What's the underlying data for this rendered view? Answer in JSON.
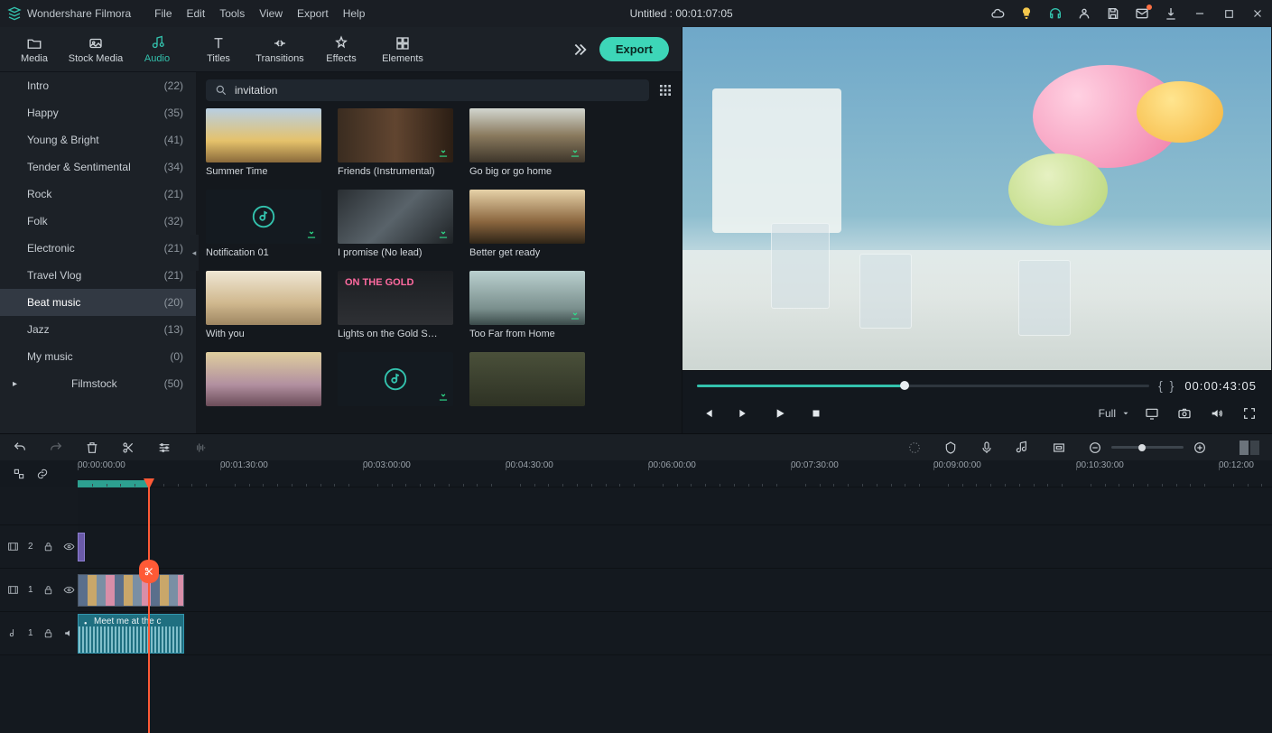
{
  "app": {
    "name": "Wondershare Filmora"
  },
  "menu": [
    "File",
    "Edit",
    "Tools",
    "View",
    "Export",
    "Help"
  ],
  "document": {
    "title_status": "Untitled : 00:01:07:05"
  },
  "tabs": {
    "items": [
      {
        "label": "Media",
        "icon": "folder"
      },
      {
        "label": "Stock Media",
        "icon": "stock"
      },
      {
        "label": "Audio",
        "icon": "music"
      },
      {
        "label": "Titles",
        "icon": "text"
      },
      {
        "label": "Transitions",
        "icon": "transition"
      },
      {
        "label": "Effects",
        "icon": "sparkle"
      },
      {
        "label": "Elements",
        "icon": "elements"
      }
    ],
    "active": 2,
    "export_label": "Export"
  },
  "search": {
    "value": "invitation"
  },
  "categories": [
    {
      "label": "Intro",
      "count": "(22)"
    },
    {
      "label": "Happy",
      "count": "(35)"
    },
    {
      "label": "Young & Bright",
      "count": "(41)"
    },
    {
      "label": "Tender & Sentimental",
      "count": "(34)"
    },
    {
      "label": "Rock",
      "count": "(21)"
    },
    {
      "label": "Folk",
      "count": "(32)"
    },
    {
      "label": "Electronic",
      "count": "(21)"
    },
    {
      "label": "Travel Vlog",
      "count": "(21)"
    },
    {
      "label": "Beat music",
      "count": "(20)",
      "selected": true
    },
    {
      "label": "Jazz",
      "count": "(13)"
    },
    {
      "label": "My music",
      "count": "(0)"
    },
    {
      "label": "Filmstock",
      "count": "(50)",
      "filmstock": true
    }
  ],
  "assets": [
    {
      "caption": "Summer Time",
      "scene": "sc-sunflower",
      "dl": false
    },
    {
      "caption": "Friends (Instrumental)",
      "scene": "sc-friends",
      "dl": true
    },
    {
      "caption": "Go big or go home",
      "scene": "sc-road",
      "dl": true
    },
    {
      "caption": "Notification 01",
      "scene": "sc-dark",
      "dl": true,
      "musicIcon": true
    },
    {
      "caption": "I promise (No lead)",
      "scene": "sc-guitar",
      "dl": true
    },
    {
      "caption": "Better get ready",
      "scene": "sc-sunset",
      "dl": false
    },
    {
      "caption": "With you",
      "scene": "sc-beach",
      "dl": false
    },
    {
      "caption": "Lights on the Gold S…",
      "scene": "sc-gold",
      "dl": false,
      "goldText": true
    },
    {
      "caption": "Too Far from Home",
      "scene": "sc-home",
      "dl": true
    },
    {
      "caption": "",
      "scene": "sc-woman",
      "dl": false
    },
    {
      "caption": "",
      "scene": "sc-dark",
      "dl": true,
      "musicIcon": true
    },
    {
      "caption": "",
      "scene": "sc-flowerhead",
      "dl": false
    }
  ],
  "preview": {
    "timecode": "00:00:43:05",
    "in_out": "{        }",
    "quality_label": "Full"
  },
  "ruler": [
    "00:00:00:00",
    "00:01:30:00",
    "00:03:00:00",
    "00:04:30:00",
    "00:06:00:00",
    "00:07:30:00",
    "00:09:00:00",
    "00:10:30:00",
    "00:12:00"
  ],
  "tracks": {
    "video2": "2",
    "video1": "1",
    "audio1": "1",
    "audio_clip_label": "Meet me at the c"
  }
}
